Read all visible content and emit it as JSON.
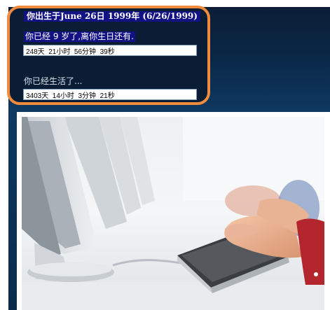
{
  "info": {
    "birth_title": "你出生于June 26日  1999年  (6/26/1999)",
    "age_countdown_label": "你已经  9 岁了,离你生日还有.",
    "countdown_value": "248天  21小时  56分钟  39秒",
    "lived_label": "你已经生活了...",
    "lived_value": "3403天  14小时  3分钟  21秒"
  },
  "colors": {
    "panel_bg": "#0a2746",
    "highlight_border": "#f08a3c",
    "title_bg": "#121284"
  },
  "photo": {
    "icon": "computer-keyboard-photo"
  }
}
